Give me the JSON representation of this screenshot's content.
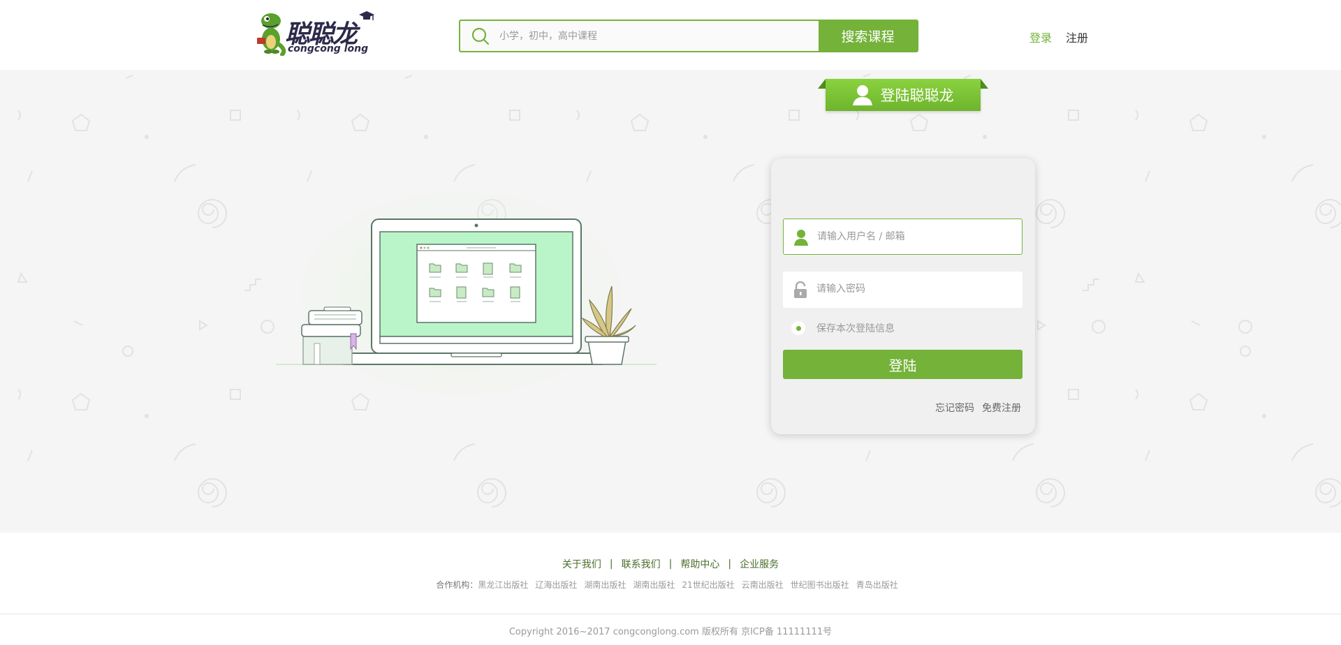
{
  "header": {
    "logo_cn": "聪聪龙",
    "logo_en": "congcong long",
    "search_placeholder": "小学，初中，高中课程",
    "search_button": "搜索课程",
    "login_link": "登录",
    "register_link": "注册"
  },
  "login": {
    "title": "登陆聪聪龙",
    "username_placeholder": "请输入用户名 / 邮箱",
    "password_placeholder": "请输入密码",
    "remember_label": "保存本次登陆信息",
    "remember_checked": true,
    "submit_label": "登陆",
    "forgot_link": "忘记密码",
    "free_register_link": "免费注册"
  },
  "footer": {
    "nav": [
      "关于我们",
      "联系我们",
      "帮助中心",
      "企业服务"
    ],
    "nav_separator": "|",
    "partners_label": "合作机构：",
    "partners": [
      "黑龙江出版社",
      "辽海出版社",
      "湖南出版社",
      "湖南出版社",
      "21世纪出版社",
      "云南出版社",
      "世纪图书出版社",
      "青岛出版社"
    ],
    "copyright": "Copyright 2016~2017 congconglong.com 版权所有 京ICP备 11111111号"
  },
  "colors": {
    "accent": "#74b23a",
    "ribbon_light": "#8ad23f",
    "background_band": "#f5f5f5",
    "text_dark": "#333333"
  },
  "icons": {
    "search": "search-icon",
    "user": "user-icon",
    "lock": "lock-icon",
    "mascot": "dinosaur-mascot-icon"
  }
}
